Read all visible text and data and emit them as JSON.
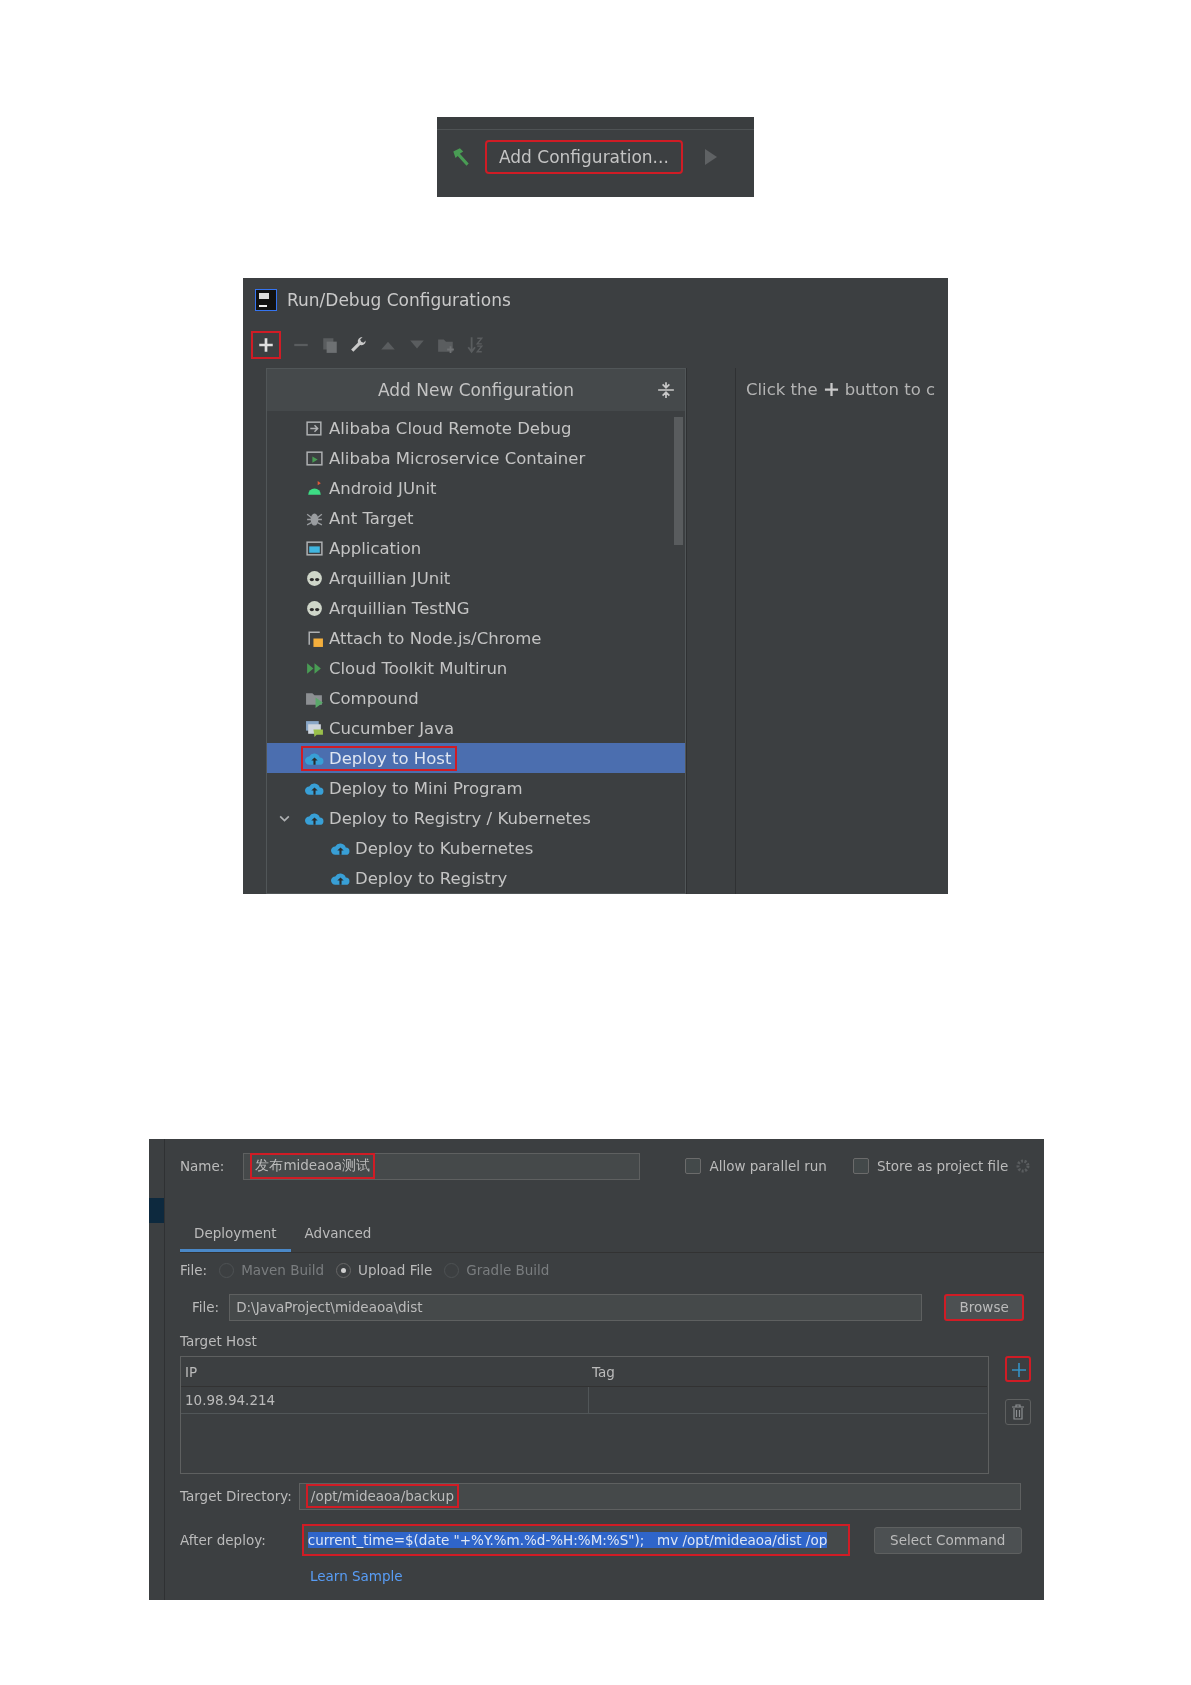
{
  "toolbar_strip": {
    "button": {
      "label": "Add Configuration...",
      "highlighted": true
    }
  },
  "run_debug_dialog": {
    "title": "Run/Debug Configurations",
    "add_button_highlighted": true,
    "popup": {
      "title": "Add New Configuration",
      "items": [
        {
          "label": "Alibaba Cloud Remote Debug",
          "selected": false,
          "highlighted": false
        },
        {
          "label": "Alibaba Microservice Container",
          "selected": false,
          "highlighted": false
        },
        {
          "label": "Android JUnit",
          "selected": false,
          "highlighted": false
        },
        {
          "label": "Ant Target",
          "selected": false,
          "highlighted": false
        },
        {
          "label": "Application",
          "selected": false,
          "highlighted": false
        },
        {
          "label": "Arquillian JUnit",
          "selected": false,
          "highlighted": false
        },
        {
          "label": "Arquillian TestNG",
          "selected": false,
          "highlighted": false
        },
        {
          "label": "Attach to Node.js/Chrome",
          "selected": false,
          "highlighted": false
        },
        {
          "label": "Cloud Toolkit Multirun",
          "selected": false,
          "highlighted": false
        },
        {
          "label": "Compound",
          "selected": false,
          "highlighted": false
        },
        {
          "label": "Cucumber Java",
          "selected": false,
          "highlighted": false
        },
        {
          "label": "Deploy to Host",
          "selected": true,
          "highlighted": true
        },
        {
          "label": "Deploy to Mini Program",
          "selected": false,
          "highlighted": false
        },
        {
          "label": "Deploy to Registry / Kubernetes",
          "selected": false,
          "highlighted": false,
          "expanded": true,
          "children": [
            {
              "label": "Deploy to Kubernetes",
              "selected": false,
              "highlighted": false
            },
            {
              "label": "Deploy to Registry",
              "selected": false,
              "highlighted": false
            }
          ]
        }
      ]
    },
    "hint": {
      "before": "Click the",
      "after": "button to c"
    }
  },
  "config_form": {
    "name": {
      "label": "Name:",
      "value": "发布mideaoa测试",
      "highlighted": true
    },
    "options": [
      {
        "label": "Allow parallel run",
        "checked": false
      },
      {
        "label": "Store as project file",
        "checked": false
      }
    ],
    "tabs": [
      {
        "label": "Deployment",
        "selected": true
      },
      {
        "label": "Advanced",
        "selected": false
      }
    ],
    "file_type": {
      "label": "File:",
      "options": [
        {
          "label": "Maven Build",
          "selected": false,
          "disabled": true
        },
        {
          "label": "Upload File",
          "selected": true,
          "disabled": false
        },
        {
          "label": "Gradle Build",
          "selected": false,
          "disabled": true
        }
      ]
    },
    "file": {
      "label": "File:",
      "value": "D:\\JavaProject\\mideaoa\\dist"
    },
    "browse_button": {
      "label": "Browse",
      "highlighted": true
    },
    "target_host": {
      "label": "Target Host",
      "columns": [
        "IP",
        "Tag"
      ],
      "rows": [
        [
          "10.98.94.214"
        ]
      ],
      "add_highlighted": true
    },
    "target_directory": {
      "label": "Target Directory:",
      "value": "/opt/mideaoa/backup",
      "highlighted": true
    },
    "after_deploy": {
      "label": "After deploy:",
      "value": "current_time=$(date \"+%Y.%m.%d-%H:%M:%S\");   mv /opt/mideaoa/dist /op",
      "highlighted": true,
      "text_selected": true
    },
    "select_command_button": {
      "label": "Select Command",
      "highlighted": false
    },
    "learn_link": "Learn Sample"
  }
}
